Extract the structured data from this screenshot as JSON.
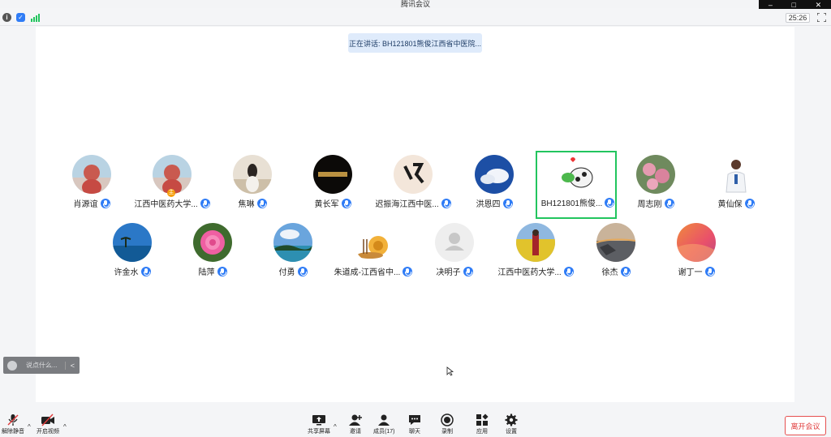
{
  "app": {
    "title": "腾讯会议"
  },
  "window_controls": {
    "minimize": "–",
    "maximize": "□",
    "close": "✕"
  },
  "status": {
    "timer": "25:26"
  },
  "speaking": {
    "text": "正在讲话: BH121801熊俊江西省中医院..."
  },
  "participants": [
    {
      "name": "肖源谊",
      "avatar": "photo-girl"
    },
    {
      "name": "江西中医药大学...",
      "avatar": "photo-girl",
      "host": true
    },
    {
      "name": "焦琳",
      "avatar": "photo-girl-sitting"
    },
    {
      "name": "黄长军",
      "avatar": "calligraphy-dark"
    },
    {
      "name": "迟振海江西中医...",
      "avatar": "calligraphy-ren"
    },
    {
      "name": "洪恩四",
      "avatar": "sky-clouds"
    },
    {
      "name": "BH121801熊俊...",
      "avatar": "cartoon-cow",
      "active": true
    },
    {
      "name": "周志刚",
      "avatar": "flowers-pink"
    },
    {
      "name": "黄仙保",
      "avatar": "doctor"
    },
    {
      "name": "许金水",
      "avatar": "sea-island"
    },
    {
      "name": "陆萍",
      "avatar": "rose"
    },
    {
      "name": "付勇",
      "avatar": "coast"
    },
    {
      "name": "朱道成-江西省中...",
      "avatar": "snail"
    },
    {
      "name": "决明子",
      "avatar": "default-user"
    },
    {
      "name": "江西中医药大学...",
      "avatar": "rapeseed-field"
    },
    {
      "name": "徐杰",
      "avatar": "sunset-coast"
    },
    {
      "name": "谢丁一",
      "avatar": "orange-gradient"
    }
  ],
  "chat": {
    "placeholder": "说点什么...",
    "collapse": "<"
  },
  "toolbar": {
    "unmute": "解除静音",
    "start_video": "开启视频",
    "share_screen": "共享屏幕",
    "invite": "邀请",
    "members": "成员(17)",
    "chat": "聊天",
    "record": "录制",
    "apps": "应用",
    "settings": "设置",
    "leave": "离开会议"
  },
  "colors": {
    "accent": "#2f7cf6",
    "active_border": "#22c55e",
    "leave": "#e03c3c"
  }
}
